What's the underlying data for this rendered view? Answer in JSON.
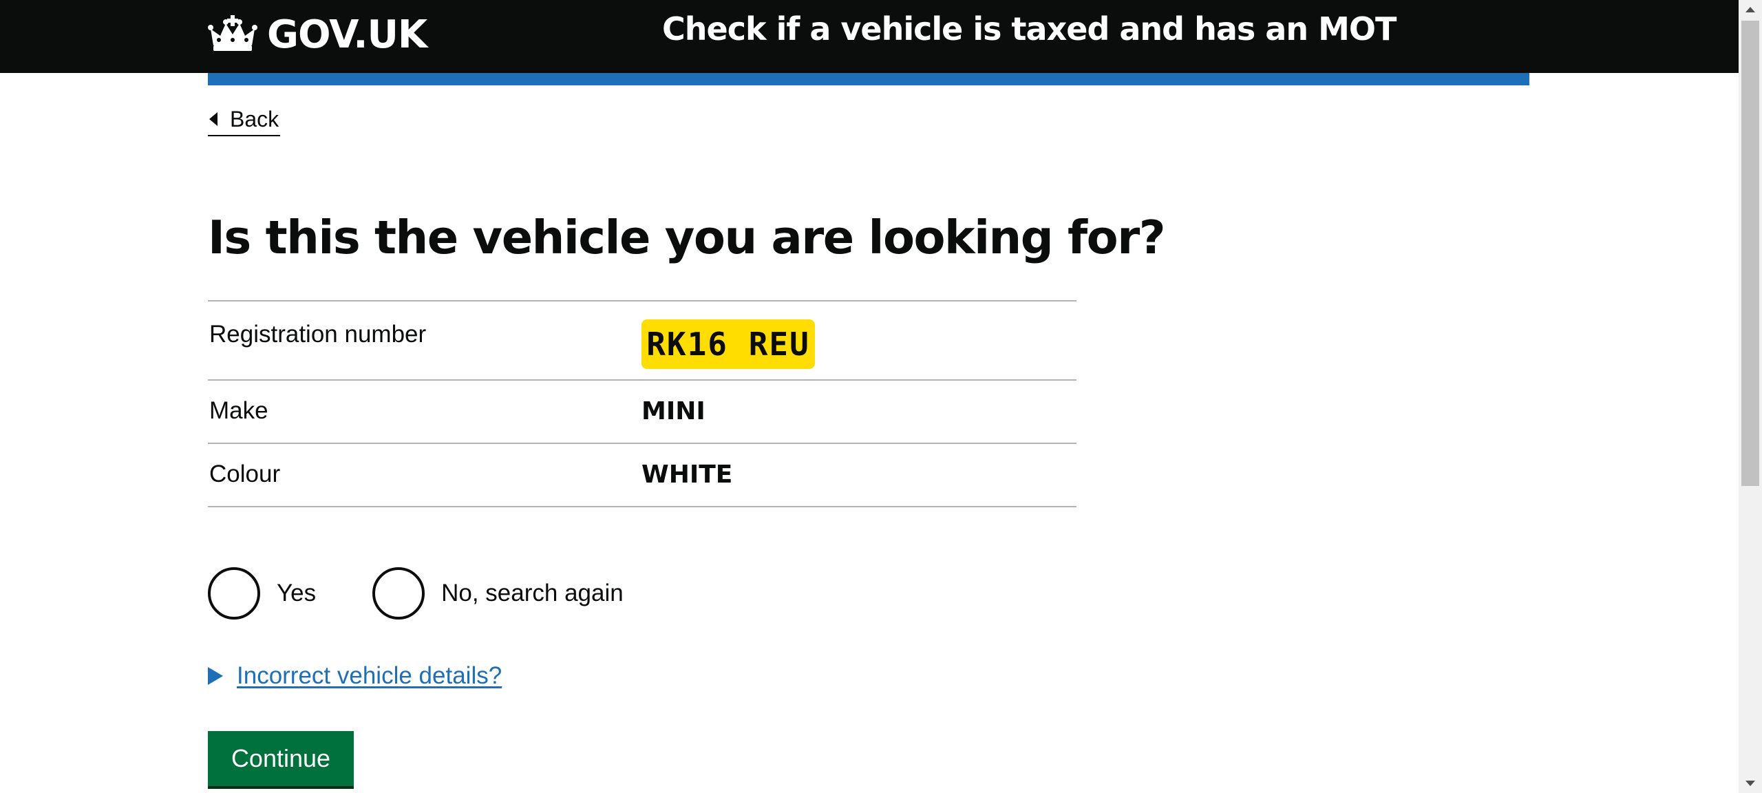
{
  "header": {
    "logo_text": "GOV.UK",
    "logo_icon": "crown-icon",
    "service_name": "Check if a vehicle is taxed and has an MOT"
  },
  "back_link": {
    "label": "Back",
    "icon": "triangle-left-icon"
  },
  "page": {
    "heading": "Is this the vehicle you are looking for?"
  },
  "summary": {
    "registration": {
      "key": "Registration number",
      "value": "RK16 REU"
    },
    "make": {
      "key": "Make",
      "value": "MINI"
    },
    "colour": {
      "key": "Colour",
      "value": "WHITE"
    }
  },
  "radios": {
    "yes_label": "Yes",
    "no_label": "No, search again",
    "selected": null
  },
  "details": {
    "summary_text": "Incorrect vehicle details?",
    "icon": "triangle-right-icon"
  },
  "button": {
    "continue_label": "Continue"
  },
  "colors": {
    "header_bg": "#0b0c0c",
    "brand_blue": "#1d70b8",
    "plate_yellow": "#ffdd00",
    "button_green": "#00703c"
  }
}
